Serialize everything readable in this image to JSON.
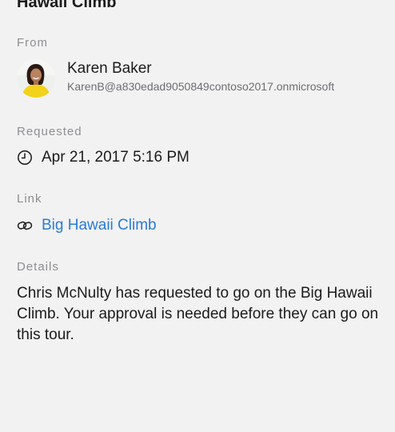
{
  "header": {
    "title": "Hawaii Climb"
  },
  "from": {
    "label": "From",
    "name": "Karen Baker",
    "email": "KarenB@a830edad9050849contoso2017.onmicrosoft"
  },
  "requested": {
    "label": "Requested",
    "datetime": "Apr 21, 2017 5:16 PM",
    "icon": "clock-icon"
  },
  "link": {
    "label": "Link",
    "text": "Big Hawaii Climb",
    "icon": "link-icon",
    "color": "#2b7bd6"
  },
  "details": {
    "label": "Details",
    "text": "Chris McNulty has requested to go on the Big Hawaii Climb. Your approval is needed before they can go on this tour."
  }
}
